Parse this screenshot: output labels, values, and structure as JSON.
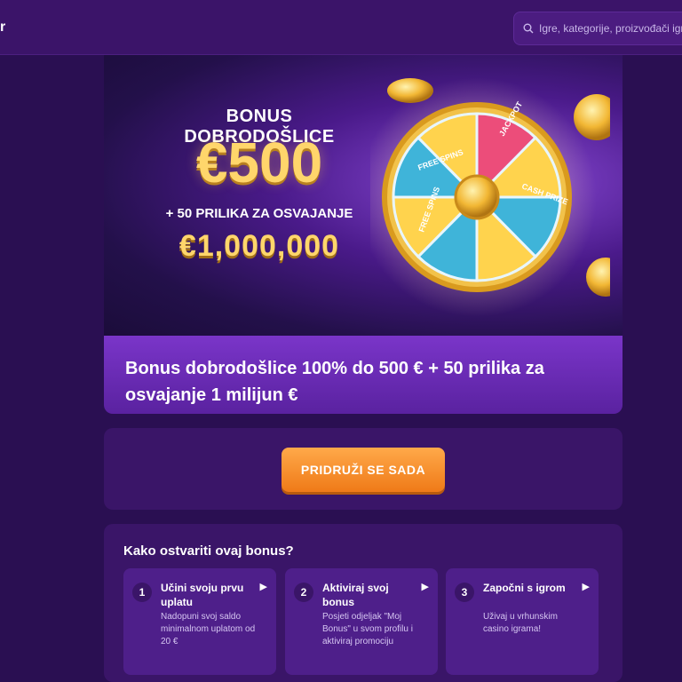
{
  "header": {
    "logo_fragment": "r",
    "search": {
      "placeholder": "Igre, kategorije, proizvođači igr"
    }
  },
  "banner": {
    "title": "BONUS DOBRODOŠLICE",
    "amount": "€500",
    "subtitle": "+ 50 PRILIKA ZA OSVAJANJE",
    "big_amount": "€1,000,000",
    "wheel_labels": [
      "JACKPOT",
      "CASH PRIZE",
      "FREE SPINS",
      "FREE SPINS"
    ]
  },
  "offer": {
    "text": "Bonus dobrodošlice 100% do 500 € + 50 prilika za osvajanje 1 milijun €"
  },
  "cta": {
    "label": "PRIDRUŽI SE SADA"
  },
  "how": {
    "title": "Kako ostvariti ovaj bonus?",
    "steps": [
      {
        "num": "1",
        "title": "Učini svoju prvu uplatu",
        "desc": "Nadopuni svoj saldo minimalnom uplatom od 20 €"
      },
      {
        "num": "2",
        "title": "Aktiviraj svoj bonus",
        "desc": "Posjeti odjeljak \"Moj Bonus\" u svom profilu i aktiviraj promociju"
      },
      {
        "num": "3",
        "title": "Započni s igrom",
        "desc": "Uživaj u vrhunskim casino igrama!"
      }
    ]
  },
  "colors": {
    "accent": "#ef7a18",
    "gold": "#ffd66b",
    "background": "#2a0f52",
    "panel": "#3a1568"
  }
}
